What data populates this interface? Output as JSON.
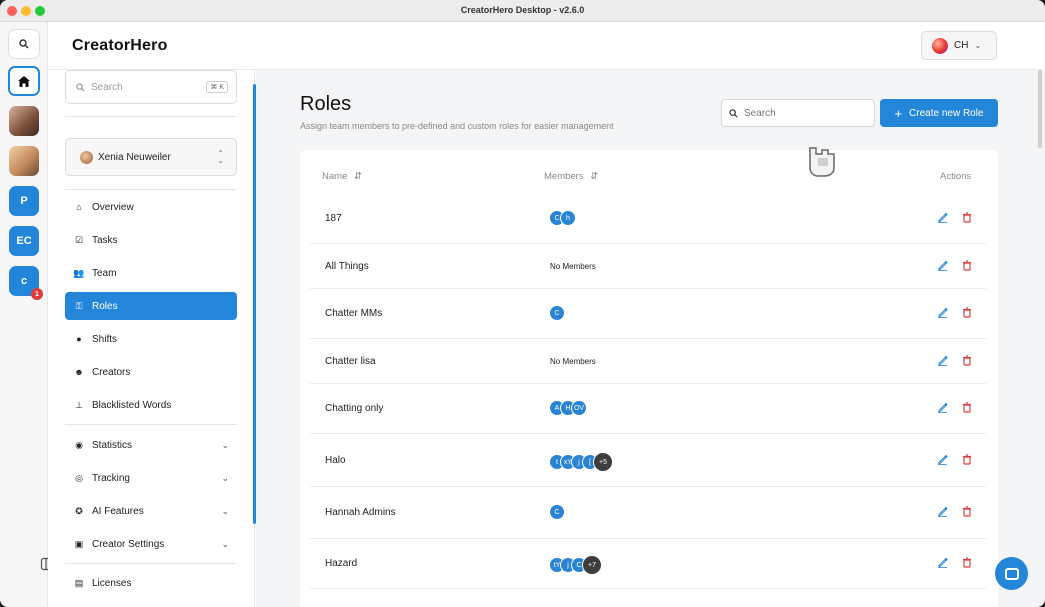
{
  "window": {
    "title": "CreatorHero Desktop - v2.6.0"
  },
  "rail": {
    "items": [
      {
        "label": "P"
      },
      {
        "label": "EC"
      },
      {
        "label": "c",
        "badge": "1"
      }
    ]
  },
  "header": {
    "logo": "CreatorHero",
    "account_label": "CH"
  },
  "sidebar": {
    "search_placeholder": "Search",
    "search_shortcut": "⌘ K",
    "user_name": "Xenia Neuweiler",
    "nav": [
      {
        "label": "Overview"
      },
      {
        "label": "Tasks"
      },
      {
        "label": "Team"
      },
      {
        "label": "Roles"
      },
      {
        "label": "Shifts"
      },
      {
        "label": "Creators"
      },
      {
        "label": "Blacklisted Words"
      },
      {
        "label": "Statistics"
      },
      {
        "label": "Tracking"
      },
      {
        "label": "AI Features"
      },
      {
        "label": "Creator Settings"
      },
      {
        "label": "Licenses"
      }
    ]
  },
  "main": {
    "title": "Roles",
    "subtitle": "Assign team members to pre-defined and custom roles for easier management",
    "search_placeholder": "Search",
    "create_button": "Create new Role",
    "columns": {
      "name": "Name",
      "members": "Members",
      "actions": "Actions"
    },
    "no_members_text": "No Members",
    "rows": [
      {
        "name": "187",
        "members": [
          "C",
          "h"
        ]
      },
      {
        "name": "All Things",
        "members": []
      },
      {
        "name": "Chatter MMs",
        "members": [
          "C"
        ]
      },
      {
        "name": "Chatter lisa",
        "members": []
      },
      {
        "name": "Chatting only",
        "members": [
          "A",
          "H",
          "OV"
        ]
      },
      {
        "name": "Halo",
        "members": [
          "t",
          "xY",
          "j",
          "[",
          "+5"
        ]
      },
      {
        "name": "Hannah Admins",
        "members": [
          "C"
        ]
      },
      {
        "name": "Hazard",
        "members": [
          "tY",
          "j",
          "C",
          "+7"
        ]
      }
    ]
  },
  "colors": {
    "accent": "#2486d8",
    "danger": "#e03b3b"
  }
}
